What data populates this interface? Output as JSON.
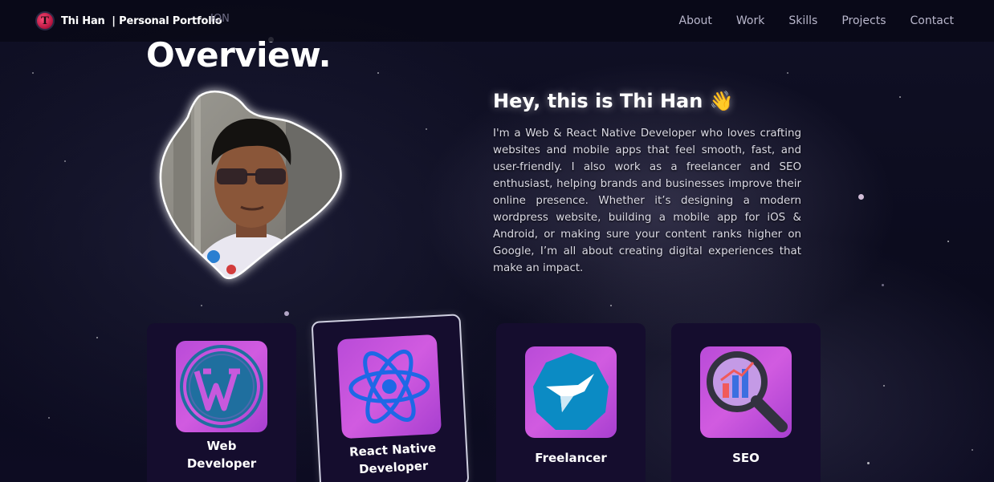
{
  "nav": {
    "brand": "Thi Han  | Personal Portfolio",
    "logo_letter": "T",
    "links": [
      "About",
      "Work",
      "Skills",
      "Projects",
      "Contact"
    ]
  },
  "section": {
    "subtitle_ghost": "ION",
    "title": "Overview."
  },
  "intro": {
    "greeting": "Hey, this is Thi Han 👋",
    "bio": "I'm a Web & React Native Developer who loves crafting websites and mobile apps that feel smooth, fast, and user-friendly. I also work as a freelancer and SEO enthusiast, helping brands and businesses improve their online presence. Whether it’s designing a modern wordpress website, building a mobile app for iOS & Android, or making sure your content ranks higher on Google, I’m all about creating digital experiences that make an impact."
  },
  "cards": [
    {
      "label_line1": "Web",
      "label_line2": "Developer",
      "icon": "wordpress-icon"
    },
    {
      "label_line1": "React Native",
      "label_line2": "Developer",
      "icon": "react-icon"
    },
    {
      "label_line1": "Freelancer",
      "label_line2": "",
      "icon": "freelancer-icon"
    },
    {
      "label_line1": "SEO",
      "label_line2": "",
      "icon": "seo-magnifier-icon"
    }
  ],
  "colors": {
    "accent_gradient_start": "#b94bd8",
    "card_bg": "#150d2e",
    "page_bg": "#0b0a1c"
  }
}
